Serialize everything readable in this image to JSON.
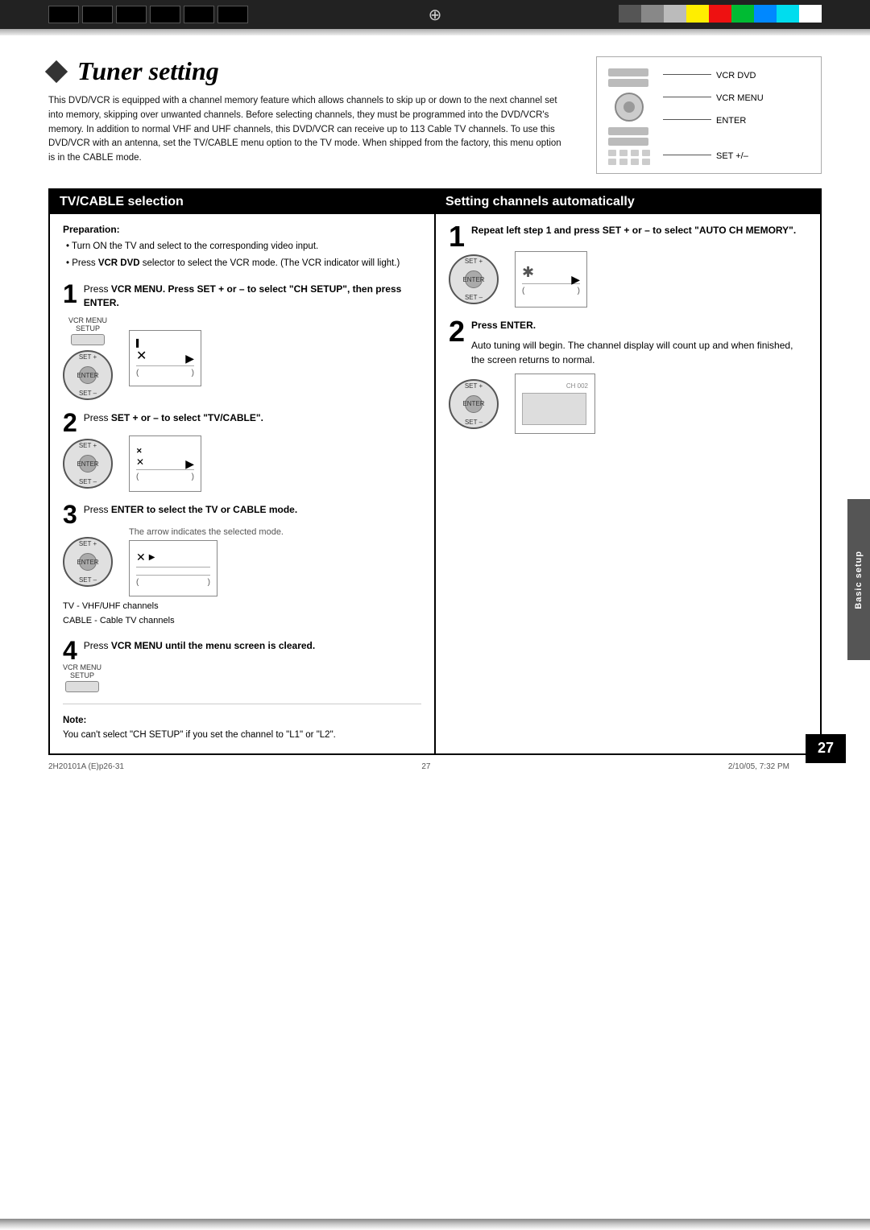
{
  "page": {
    "number": "27",
    "footer_left": "2H20101A (E)p26-31",
    "footer_center": "27",
    "footer_right": "2/10/05, 7:32 PM"
  },
  "top_bar": {
    "colors": [
      "#000000",
      "#444444",
      "#888888",
      "#bbbbbb",
      "#ffff00",
      "#ff0000",
      "#00aa00",
      "#00aaff",
      "#00ffff",
      "#ffffff"
    ]
  },
  "side_tab": {
    "label": "Basic setup"
  },
  "title": "Tuner setting",
  "intro": "This DVD/VCR is equipped with a channel memory feature which allows channels to skip up or down to the next channel set into memory, skipping over unwanted channels. Before selecting channels, they must be programmed into the DVD/VCR's memory. In addition to normal VHF and UHF channels, this DVD/VCR can receive up to 113 Cable TV channels. To use this DVD/VCR with an antenna, set the TV/CABLE menu option to the TV mode. When shipped from the factory, this menu option is in the CABLE mode.",
  "remote_labels": {
    "vcr_dvd": "VCR DVD",
    "vcr_menu": "VCR MENU",
    "enter": "ENTER",
    "set_plus_minus": "SET +/–"
  },
  "left_section": {
    "header": "TV/CABLE selection",
    "preparation_label": "Preparation:",
    "prep_bullets": [
      "Turn ON the TV and select to the corresponding video input.",
      "Press VCR DVD selector to select the VCR mode. (The VCR indicator will light.)"
    ],
    "step1": {
      "number": "1",
      "instruction": "Press VCR MENU. Press SET + or – to select \"CH SETUP\", then press ENTER.",
      "vcr_label": "VCR MENU\nSETUP"
    },
    "step2": {
      "number": "2",
      "instruction": "Press SET + or – to select \"TV/CABLE\"."
    },
    "step3": {
      "number": "3",
      "instruction": "Press ENTER to select the TV or CABLE mode.",
      "sub_text": "The arrow indicates the selected mode.",
      "tv_line": "TV     - VHF/UHF channels",
      "cable_line": "CABLE - Cable TV channels"
    },
    "step4": {
      "number": "4",
      "instruction": "Press VCR MENU until the menu screen is cleared.",
      "vcr_label": "VCR MENU\nSETUP"
    },
    "note_label": "Note:",
    "note_text": "You can't select \"CH SETUP\" if you set the channel to \"L1\" or \"L2\"."
  },
  "right_section": {
    "header": "Setting channels automatically",
    "step1": {
      "number": "1",
      "instruction": "Repeat left step 1 and press SET + or – to select \"AUTO CH MEMORY\"."
    },
    "step2": {
      "number": "2",
      "instruction": "Press ENTER.",
      "sub_text": "Auto tuning will begin. The channel display will count up and when finished, the screen returns to normal.",
      "screen_label": "CH 002"
    }
  }
}
